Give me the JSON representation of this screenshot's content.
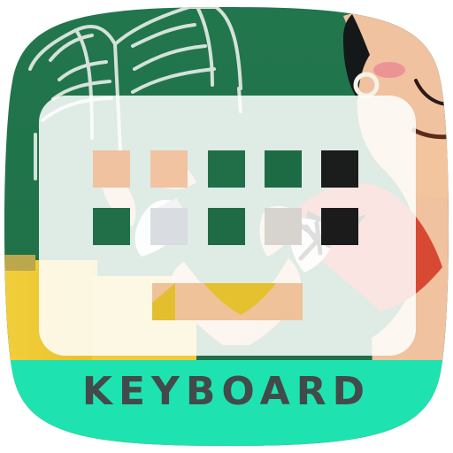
{
  "app_icon": {
    "label": "KEYBOARD",
    "accent_color": "#1ee3b0",
    "label_color": "#424b4a"
  }
}
